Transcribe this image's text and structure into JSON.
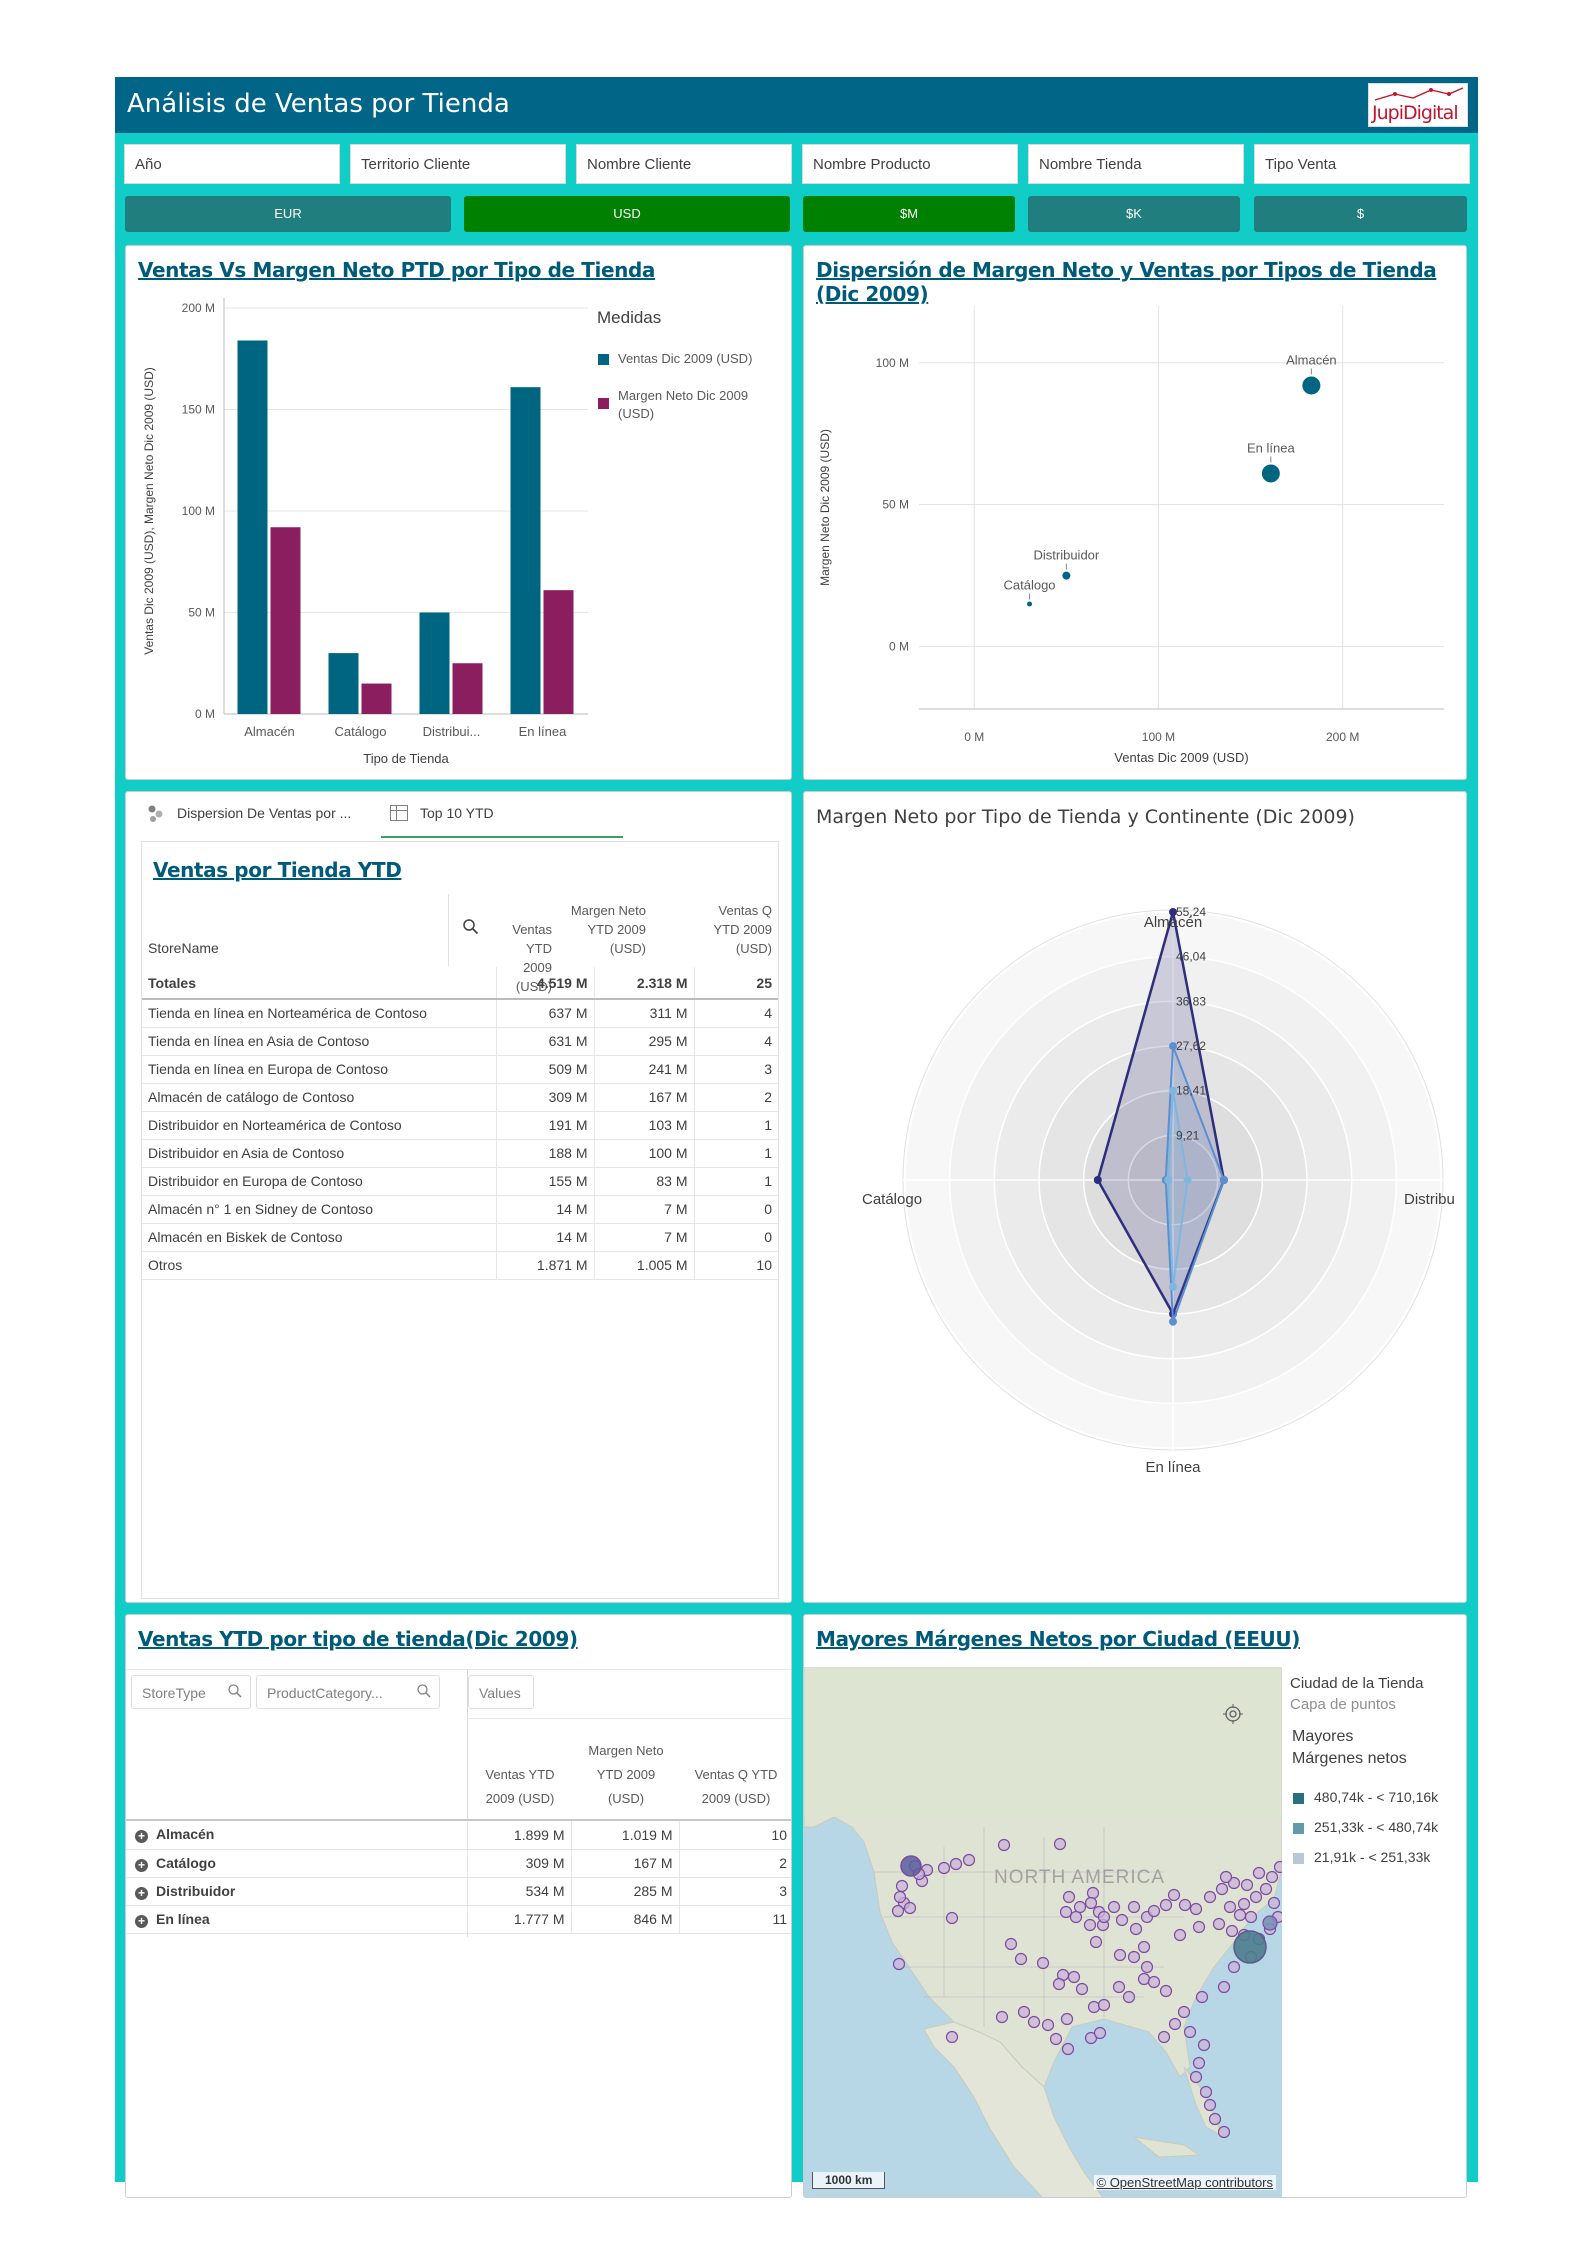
{
  "header": {
    "title": "Análisis de Ventas por Tienda",
    "logo_text": "JupiDigital"
  },
  "filters": [
    "Año",
    "Territorio Cliente",
    "Nombre Cliente",
    "Nombre Producto",
    "Nombre Tienda",
    "Tipo Venta"
  ],
  "currency_buttons": [
    {
      "label": "EUR",
      "color": "#217e7e"
    },
    {
      "label": "USD",
      "color": "#008000"
    },
    {
      "label": "$M",
      "color": "#008000"
    },
    {
      "label": "$K",
      "color": "#217e7e"
    },
    {
      "label": "$",
      "color": "#217e7e"
    }
  ],
  "colors": {
    "ventas": "#006580",
    "margen": "#8b1e5e",
    "frame": "#11cdc8",
    "header": "#006587",
    "title": "#005a7a"
  },
  "panels": {
    "bar": {
      "title": "Ventas Vs Margen Neto PTD por Tipo de Tienda",
      "legend_title": "Medidas",
      "legend_ventas": "Ventas  Dic 2009 (USD)",
      "legend_margen_1": "Margen Neto  Dic 2009",
      "legend_margen_2": "(USD)"
    },
    "scatter": {
      "title": "Dispersión de Margen Neto y Ventas por Tipos de Tienda (Dic 2009)"
    },
    "table": {
      "tab1": "Dispersion De Ventas por ...",
      "tab2": "Top 10 YTD",
      "title": "Ventas por Tienda YTD",
      "col_name": "StoreName",
      "col_v": [
        "Ventas YTD",
        "2009 (USD)"
      ],
      "col_m": [
        "Margen Neto",
        "YTD 2009",
        "(USD)"
      ],
      "col_q": [
        "Ventas Q",
        "YTD 2009",
        "(USD)"
      ],
      "totals": {
        "label": "Totales",
        "v": "4.519 M",
        "m": "2.318 M",
        "q": "25"
      },
      "rows": [
        {
          "name": "Tienda en línea en Norteamérica de Contoso",
          "v": "637 M",
          "m": "311 M",
          "q": "4"
        },
        {
          "name": "Tienda en línea en Asia de Contoso",
          "v": "631 M",
          "m": "295 M",
          "q": "4"
        },
        {
          "name": "Tienda en línea en Europa de Contoso",
          "v": "509 M",
          "m": "241 M",
          "q": "3"
        },
        {
          "name": "Almacén de catálogo de Contoso",
          "v": "309 M",
          "m": "167 M",
          "q": "2"
        },
        {
          "name": "Distribuidor en Norteamérica de Contoso",
          "v": "191 M",
          "m": "103 M",
          "q": "1"
        },
        {
          "name": "Distribuidor en Asia de Contoso",
          "v": "188 M",
          "m": "100 M",
          "q": "1"
        },
        {
          "name": "Distribuidor en Europa de Contoso",
          "v": "155 M",
          "m": "83 M",
          "q": "1"
        },
        {
          "name": "Almacén n° 1 en Sidney de Contoso",
          "v": "14 M",
          "m": "7 M",
          "q": "0"
        },
        {
          "name": "Almacén en Biskek de Contoso",
          "v": "14 M",
          "m": "7 M",
          "q": "0"
        },
        {
          "name": "Otros",
          "v": "1.871 M",
          "m": "1.005 M",
          "q": "10"
        }
      ]
    },
    "radar": {
      "title": "Margen Neto por Tipo de Tienda y Continente (Dic 2009)"
    },
    "pivot": {
      "title": "Ventas YTD por tipo de tienda(Dic 2009)",
      "dim1": "StoreType",
      "dim2": "ProductCategory...",
      "values_label": "Values",
      "col_v": [
        "Ventas YTD",
        "2009 (USD)"
      ],
      "col_m": [
        "Margen Neto",
        "YTD 2009",
        "(USD)"
      ],
      "col_q": [
        "Ventas Q YTD",
        "2009 (USD)"
      ],
      "rows": [
        {
          "name": "Almacén",
          "v": "1.899 M",
          "m": "1.019 M",
          "q": "10"
        },
        {
          "name": "Catálogo",
          "v": "309 M",
          "m": "167 M",
          "q": "2"
        },
        {
          "name": "Distribuidor",
          "v": "534 M",
          "m": "285 M",
          "q": "3"
        },
        {
          "name": "En línea",
          "v": "1.777 M",
          "m": "846 M",
          "q": "11"
        }
      ]
    },
    "map": {
      "title": "Mayores Márgenes Netos por Ciudad (EEUU)",
      "region_label": "NORTH AMERICA",
      "scale_label": "1000 km",
      "attribution": "© OpenStreetMap contributors",
      "legend_layer": "Ciudad de la Tienda",
      "legend_sub": "Capa de puntos",
      "legend_measure_1": "Mayores",
      "legend_measure_2": "Márgenes netos",
      "legend_items": [
        {
          "label": "480,74k - < 710,16k",
          "color": "#2a6f7d"
        },
        {
          "label": "251,33k - < 480,74k",
          "color": "#5f9bab"
        },
        {
          "label": "21,91k - < 251,33k",
          "color": "#b8c8d8"
        }
      ]
    }
  },
  "chart_data": [
    {
      "type": "bar",
      "title": "Ventas Vs Margen Neto PTD por Tipo de Tienda",
      "categories": [
        "Almacén",
        "Catálogo",
        "Distribui...",
        "En línea"
      ],
      "series": [
        {
          "name": "Ventas  Dic 2009 (USD)",
          "values": [
            184,
            30,
            50,
            161
          ]
        },
        {
          "name": "Margen Neto  Dic 2009 (USD)",
          "values": [
            92,
            15,
            25,
            61
          ]
        }
      ],
      "xlabel": "Tipo de Tienda",
      "ylabel": "Ventas Dic 2009 (USD), Margen Neto Dic 2009 (USD)",
      "ylim": [
        0,
        200
      ],
      "yticks": [
        "0 M",
        "50 M",
        "100 M",
        "150 M",
        "200 M"
      ],
      "legend": "right"
    },
    {
      "type": "scatter",
      "title": "Dispersión de Margen Neto y Ventas por Tipos de Tienda (Dic 2009)",
      "xlabel": "Ventas Dic 2009 (USD)",
      "ylabel": "Margen Neto Dic 2009 (USD)",
      "xlim": [
        -30,
        255
      ],
      "ylim": [
        -22,
        120
      ],
      "xticks": [
        "0 M",
        "100 M",
        "200 M"
      ],
      "yticks": [
        "0 M",
        "50 M",
        "100 M"
      ],
      "points": [
        {
          "label": "Almacén",
          "x": 183,
          "y": 92,
          "size": 9
        },
        {
          "label": "En línea",
          "x": 161,
          "y": 61,
          "size": 9
        },
        {
          "label": "Distribuidor",
          "x": 50,
          "y": 25,
          "size": 4
        },
        {
          "label": "Catálogo",
          "x": 30,
          "y": 15,
          "size": 2.5
        }
      ]
    },
    {
      "type": "radar",
      "title": "Margen Neto por Tipo de Tienda y Continente (Dic 2009)",
      "axes": [
        "Almacén",
        "Distribuidor",
        "En línea",
        "Catálogo"
      ],
      "axes_display": [
        "Almacén",
        "Distribu",
        "En línea",
        "Catálogo"
      ],
      "rings": [
        "9,21",
        "18,41",
        "27,62",
        "36,83",
        "46,04",
        "55,24"
      ],
      "max": 55.24,
      "series": [
        {
          "color": "#2e2e7d",
          "values": [
            55.24,
            10.5,
            27.6,
            15.5
          ]
        },
        {
          "color": "#5b8fd0",
          "values": [
            27.6,
            10.5,
            29.2,
            1.5
          ]
        },
        {
          "color": "#7fb6e0",
          "values": [
            18.4,
            3,
            22,
            1
          ]
        }
      ]
    }
  ]
}
